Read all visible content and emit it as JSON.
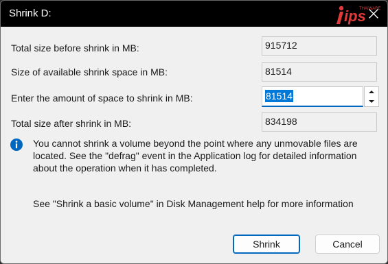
{
  "window": {
    "title": "Shrink D:",
    "watermark_text": "Tips",
    "watermark_small": "THAIWARE"
  },
  "fields": {
    "total_before": {
      "label": "Total size before shrink in MB:",
      "value": "915712"
    },
    "available": {
      "label": "Size of available shrink space in MB:",
      "value": "81514"
    },
    "amount": {
      "label": "Enter the amount of space to shrink in MB:",
      "value": "81514"
    },
    "total_after": {
      "label": "Total size after shrink in MB:",
      "value": "834198"
    }
  },
  "info": {
    "icon": "info-icon",
    "text": "You cannot shrink a volume beyond the point where any unmovable files are located. See the \"defrag\" event in the Application log for detailed information about the operation when it has completed."
  },
  "help": {
    "text": "See \"Shrink a basic volume\" in Disk Management help for more information"
  },
  "buttons": {
    "shrink": "Shrink",
    "cancel": "Cancel"
  },
  "colors": {
    "accent": "#0067c0",
    "selection": "#0078d7",
    "titlebar": "#000000",
    "info_icon": "#0067c0",
    "watermark": "#e03a3a"
  }
}
